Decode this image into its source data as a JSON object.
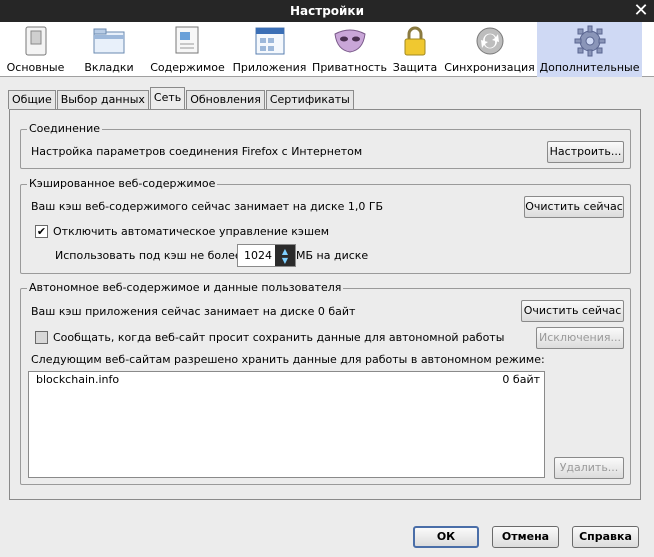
{
  "window": {
    "title": "Настройки",
    "close_icon": "close-icon"
  },
  "toolbar": {
    "items": [
      {
        "label": "Основные",
        "icon": "switch-icon"
      },
      {
        "label": "Вкладки",
        "icon": "tabs-icon"
      },
      {
        "label": "Содержимое",
        "icon": "content-icon"
      },
      {
        "label": "Приложения",
        "icon": "applications-icon"
      },
      {
        "label": "Приватность",
        "icon": "mask-icon"
      },
      {
        "label": "Защита",
        "icon": "lock-icon"
      },
      {
        "label": "Синхронизация",
        "icon": "sync-icon"
      },
      {
        "label": "Дополнительные",
        "icon": "gear-icon"
      }
    ],
    "active_index": 7
  },
  "tabs": [
    "Общие",
    "Выбор данных",
    "Сеть",
    "Обновления",
    "Сертификаты"
  ],
  "active_tab": 2,
  "connection": {
    "legend": "Соединение",
    "description": "Настройка параметров соединения Firefox с Интернетом",
    "settings_button": "Настроить..."
  },
  "cache": {
    "legend": "Кэшированное веб-содержимое",
    "usage_text": "Ваш кэш веб-содержимого сейчас занимает на диске 1,0 ГБ",
    "clear_button": "Очистить сейчас",
    "override_label": "Отключить автоматическое управление кэшем",
    "override_checked": true,
    "limit_label": "Использовать под кэш не более",
    "limit_value": "1024",
    "limit_unit": "МБ на диске"
  },
  "offline": {
    "legend": "Автономное веб-содержимое и данные пользователя",
    "usage_text": "Ваш кэш приложения сейчас занимает на диске 0 байт",
    "clear_button": "Очистить сейчас",
    "notify_label": "Сообщать, когда веб-сайт просит сохранить данные для автономной работы",
    "notify_checked": false,
    "exceptions_button": "Исключения...",
    "list_label": "Следующим веб-сайтам разрешено хранить данные для работы в автономном режиме:",
    "sites": [
      {
        "site": "blockchain.info",
        "size": "0 байт"
      }
    ],
    "remove_button": "Удалить..."
  },
  "dialog": {
    "ok": "ОК",
    "cancel": "Отмена",
    "help": "Справка"
  },
  "colors": {
    "titlebar": "#262626",
    "active_toolbar": "#cfd9f4",
    "spin_arrows": "#7fd0ff"
  }
}
